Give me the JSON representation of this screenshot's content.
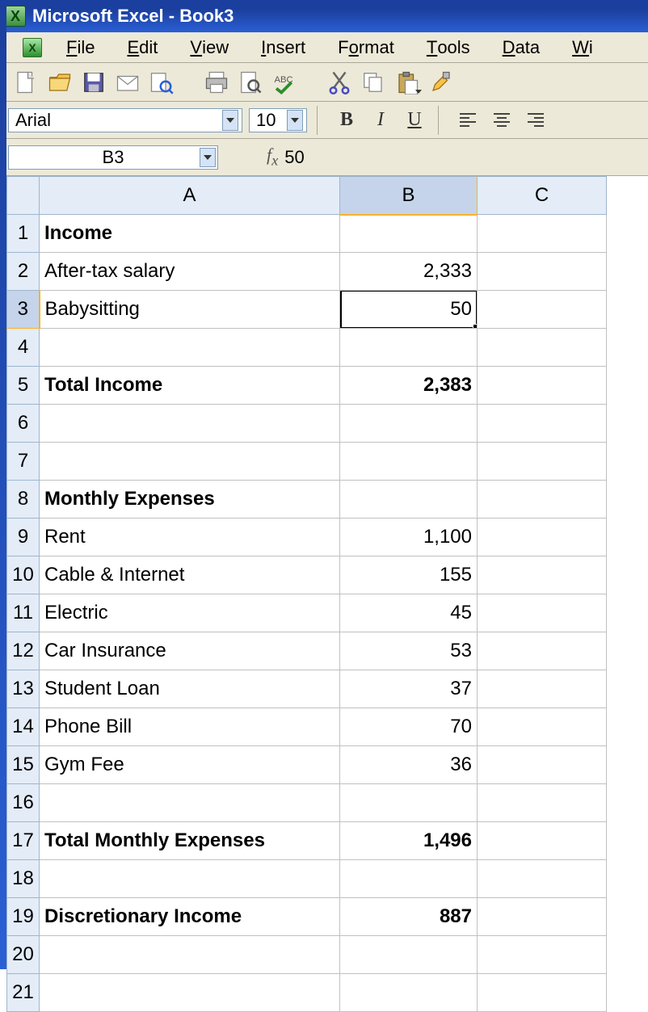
{
  "title": "Microsoft Excel - Book3",
  "menu": {
    "file": {
      "u": "F",
      "rest": "ile"
    },
    "edit": {
      "u": "E",
      "rest": "dit"
    },
    "view": {
      "u": "V",
      "rest": "iew"
    },
    "insert": {
      "u": "I",
      "rest": "nsert"
    },
    "format": {
      "pre": "F",
      "u": "o",
      "rest": "rmat"
    },
    "tools": {
      "u": "T",
      "rest": "ools"
    },
    "data": {
      "u": "D",
      "rest": "ata"
    },
    "window": {
      "u": "W",
      "rest": "i"
    }
  },
  "font": {
    "name": "Arial",
    "size": "10"
  },
  "nameBox": "B3",
  "formula": "50",
  "columns": [
    "A",
    "B",
    "C"
  ],
  "selected": {
    "row": 3,
    "col": "B"
  },
  "rows": [
    {
      "n": 1,
      "a": "Income",
      "b": "",
      "bold": true
    },
    {
      "n": 2,
      "a": "After-tax salary",
      "b": "2,333"
    },
    {
      "n": 3,
      "a": "Babysitting",
      "b": "50"
    },
    {
      "n": 4,
      "a": "",
      "b": ""
    },
    {
      "n": 5,
      "a": "Total Income",
      "b": "2,383",
      "bold": true
    },
    {
      "n": 6,
      "a": "",
      "b": ""
    },
    {
      "n": 7,
      "a": "",
      "b": ""
    },
    {
      "n": 8,
      "a": "Monthly Expenses",
      "b": "",
      "bold": true
    },
    {
      "n": 9,
      "a": "Rent",
      "b": "1,100"
    },
    {
      "n": 10,
      "a": "Cable & Internet",
      "b": "155"
    },
    {
      "n": 11,
      "a": "Electric",
      "b": "45"
    },
    {
      "n": 12,
      "a": "Car Insurance",
      "b": "53"
    },
    {
      "n": 13,
      "a": "Student Loan",
      "b": "37"
    },
    {
      "n": 14,
      "a": "Phone Bill",
      "b": "70"
    },
    {
      "n": 15,
      "a": "Gym Fee",
      "b": "36"
    },
    {
      "n": 16,
      "a": "",
      "b": ""
    },
    {
      "n": 17,
      "a": "Total Monthly Expenses",
      "b": "1,496",
      "bold": true
    },
    {
      "n": 18,
      "a": "",
      "b": ""
    },
    {
      "n": 19,
      "a": "Discretionary Income",
      "b": "887",
      "bold": true
    },
    {
      "n": 20,
      "a": "",
      "b": ""
    },
    {
      "n": 21,
      "a": "",
      "b": ""
    }
  ],
  "chart_data": {
    "type": "table",
    "Income": {
      "After-tax salary": 2333,
      "Babysitting": 50,
      "Total Income": 2383
    },
    "Monthly Expenses": {
      "Rent": 1100,
      "Cable & Internet": 155,
      "Electric": 45,
      "Car Insurance": 53,
      "Student Loan": 37,
      "Phone Bill": 70,
      "Gym Fee": 36,
      "Total Monthly Expenses": 1496
    },
    "Discretionary Income": 887
  }
}
